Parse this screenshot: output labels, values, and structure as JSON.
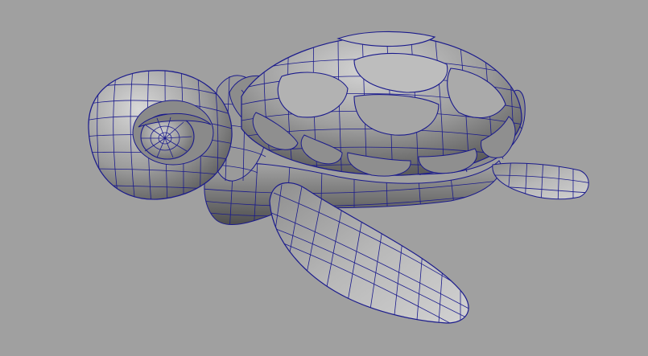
{
  "viewport": {
    "background": "#a0a0a0",
    "model": {
      "subject": "turtle-model",
      "display_mode": "smooth-shaded-with-wireframe",
      "wire_color": "#1a1a8c",
      "surface_color": "#9b9b9b",
      "highlight_color": "#d6d6d6",
      "shadow_color": "#4a4a4a"
    }
  }
}
